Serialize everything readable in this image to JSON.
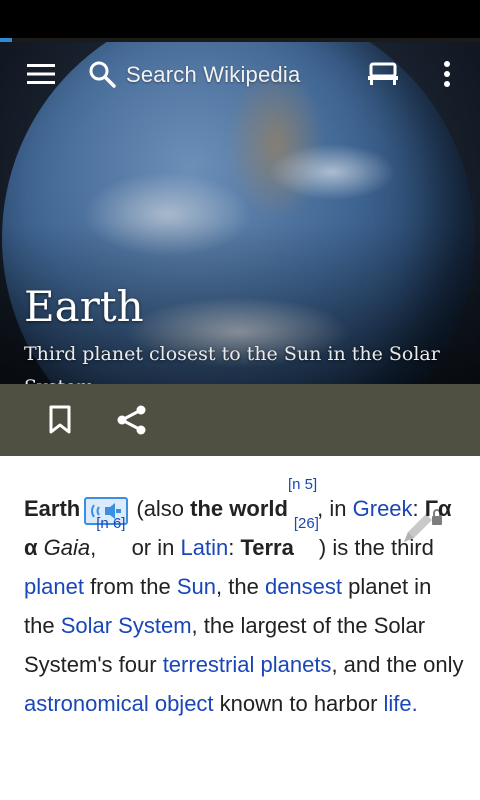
{
  "status_bar": {},
  "load_progress": 0.025,
  "toolbar": {
    "menu_icon": "hamburger-menu-icon",
    "search_icon": "search-icon",
    "search_placeholder": "Search Wikipedia",
    "reading_list_icon": "reading-list-icon",
    "overflow_icon": "overflow-menu-icon"
  },
  "hero": {
    "title": "Earth",
    "subtitle": "Third planet closest to the Sun in the Solar System"
  },
  "actions": {
    "bookmark_icon": "bookmark-icon",
    "share_icon": "share-icon"
  },
  "article": {
    "edit_icon": "edit-locked-icon",
    "lead": {
      "term": "Earth",
      "audio_icon": "audio-pronunciation-icon",
      "also_prefix": " (also ",
      "also_term": "the world",
      "ref_n5": "[n 5]",
      "after_ref_n5": ", in",
      "greek_link": "Greek",
      "colon1": ": ",
      "greek_word": "Γα α",
      "gaia": "Gaia",
      "comma1": ",",
      "ref_n6": "[n 6]",
      "or_in": " or in ",
      "latin_link": "Latin",
      "colon2": ":",
      "terra": "Terra",
      "ref_26": "[26]",
      "is_third": ") is the third ",
      "planet_link": "planet",
      "from_the": " from the ",
      "sun_link": "Sun",
      "the1": ", the ",
      "densest_link": "densest",
      "planet_in_the": " planet in the ",
      "solar_system_link": "Solar System",
      "largest_text": ", the largest of the Solar System's four ",
      "terrestrial_link": "terrestrial planets",
      "and_the_only": ", and the only ",
      "astronomical_link": "astronomical object",
      "known_to_harbor": " known to harbor ",
      "life_link": "life."
    }
  }
}
